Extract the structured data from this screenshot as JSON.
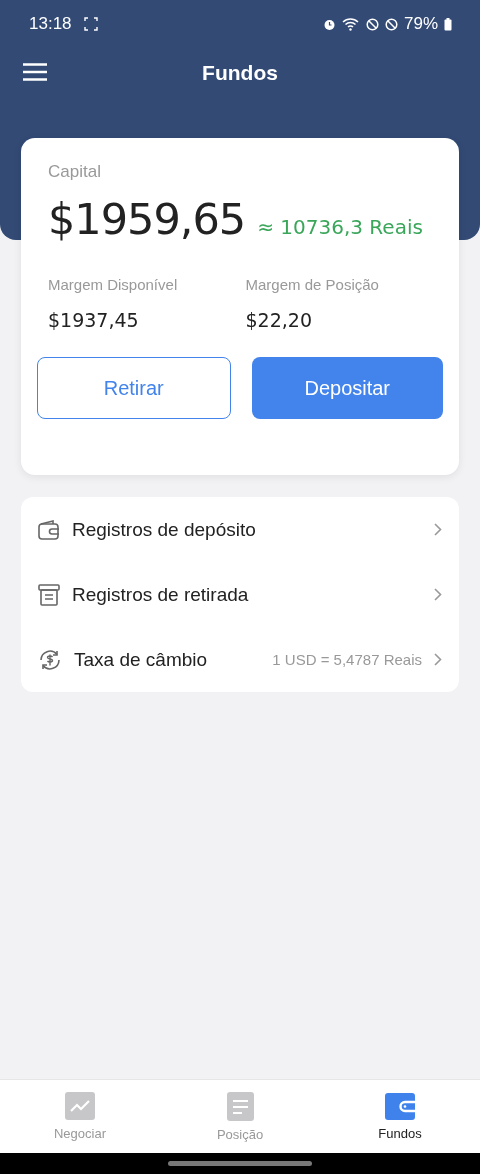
{
  "status_bar": {
    "time": "13:18",
    "battery": "79%"
  },
  "header": {
    "title": "Fundos"
  },
  "capital": {
    "label": "Capital",
    "amount": "$1959,65",
    "converted": "≈ 10736,3 Reais"
  },
  "margins": [
    {
      "label": "Margem Disponível",
      "value": "$1937,45"
    },
    {
      "label": "Margem de Posição",
      "value": "$22,20"
    }
  ],
  "buttons": [
    {
      "label": "Retirar",
      "kind": "outline"
    },
    {
      "label": "Depositar",
      "kind": "filled"
    }
  ],
  "menu": [
    {
      "label": "Registros de depósito",
      "kind": "deposit"
    },
    {
      "label": "Registros de retirada",
      "kind": "withdrawal"
    },
    {
      "label": "Taxa de câmbio",
      "kind": "exchange",
      "value": "1 USD = 5,4787 Reais"
    }
  ],
  "nav": [
    {
      "label": "Negociar",
      "kind": "chart",
      "selected": false
    },
    {
      "label": "Posição",
      "kind": "list",
      "selected": false
    },
    {
      "label": "Fundos",
      "kind": "wallet",
      "selected": true
    }
  ]
}
